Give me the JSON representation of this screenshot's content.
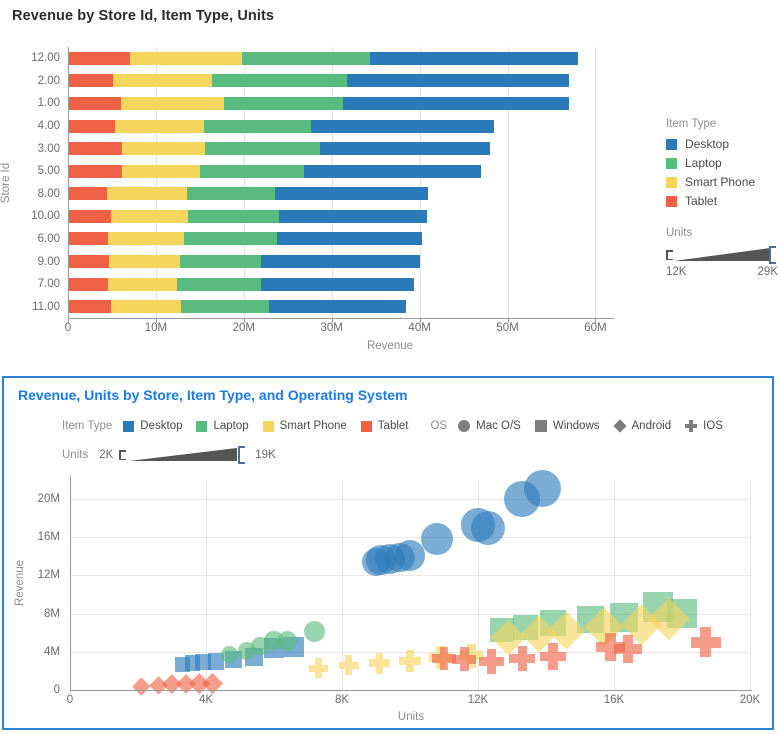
{
  "colors": {
    "desktop": "#2a7ab9",
    "laptop": "#59bb7e",
    "smart_phone": "#f6d55c",
    "tablet": "#ef6144",
    "os_gray": "#7d7d7d",
    "panel_border": "#2b7fd4",
    "panel_title": "#1a7ae8",
    "axis": "#9a9a9a",
    "grid": "#e3e3e3",
    "tick_text": "#6b6b6b",
    "axis_title": "#8d8d8d"
  },
  "bar_panel": {
    "title": "Revenue by Store Id, Item Type, Units",
    "legend": {
      "item_type_title": "Item Type",
      "items": [
        {
          "label": "Desktop",
          "color": "#2a7ab9"
        },
        {
          "label": "Laptop",
          "color": "#59bb7e"
        },
        {
          "label": "Smart Phone",
          "color": "#f6d55c"
        },
        {
          "label": "Tablet",
          "color": "#ef6144"
        }
      ],
      "units_title": "Units",
      "units_min": "12K",
      "units_max": "29K"
    }
  },
  "scatter_panel": {
    "title": "Revenue, Units by Store, Item Type, and Operating System",
    "item_type_label": "Item Type",
    "item_type_items": [
      {
        "label": "Desktop",
        "color": "#2a7ab9"
      },
      {
        "label": "Laptop",
        "color": "#59bb7e"
      },
      {
        "label": "Smart Phone",
        "color": "#f6d55c"
      },
      {
        "label": "Tablet",
        "color": "#ef6144"
      }
    ],
    "os_label": "OS",
    "os_items": [
      {
        "label": "Mac O/S",
        "shape": "circle-icon"
      },
      {
        "label": "Windows",
        "shape": "square-icon"
      },
      {
        "label": "Android",
        "shape": "diamond-icon"
      },
      {
        "label": "IOS",
        "shape": "plus-icon"
      }
    ],
    "units_label": "Units",
    "units_min": "2K",
    "units_max": "19K"
  },
  "chart_data": [
    {
      "type": "bar",
      "orientation": "horizontal",
      "stacked": true,
      "title": "Revenue by Store Id, Item Type, Units",
      "xlabel": "Revenue",
      "ylabel": "Store Id",
      "xlim": [
        0,
        62000000
      ],
      "xticks": [
        0,
        10000000,
        20000000,
        30000000,
        40000000,
        50000000,
        60000000
      ],
      "xticklabels": [
        "0",
        "10M",
        "20M",
        "30M",
        "40M",
        "50M",
        "60M"
      ],
      "grid": "vertical",
      "legend_position": "right",
      "categories": [
        "12.00",
        "2.00",
        "1.00",
        "4.00",
        "3.00",
        "5.00",
        "8.00",
        "10.00",
        "6.00",
        "9.00",
        "7.00",
        "11.00"
      ],
      "series": [
        {
          "name": "Tablet",
          "color": "#ef6144",
          "values": [
            7000000,
            5100000,
            6000000,
            5400000,
            6100000,
            6100000,
            4400000,
            4900000,
            4600000,
            4700000,
            4600000,
            4900000
          ]
        },
        {
          "name": "Smart Phone",
          "color": "#f6d55c",
          "values": [
            12800000,
            11300000,
            11800000,
            10100000,
            9500000,
            8900000,
            9100000,
            8700000,
            8600000,
            8000000,
            7800000,
            8000000
          ]
        },
        {
          "name": "Laptop",
          "color": "#59bb7e",
          "values": [
            14500000,
            15300000,
            13500000,
            12100000,
            13100000,
            11900000,
            10100000,
            10400000,
            10600000,
            9300000,
            9500000,
            10000000
          ]
        },
        {
          "name": "Desktop",
          "color": "#2a7ab9",
          "values": [
            23700000,
            25300000,
            25700000,
            20900000,
            19300000,
            20100000,
            17400000,
            16800000,
            16500000,
            18000000,
            17500000,
            15600000
          ]
        }
      ],
      "totals": [
        58000000,
        57000000,
        57000000,
        48500000,
        48000000,
        47000000,
        41000000,
        40800000,
        40300000,
        40000000,
        39400000,
        38500000
      ]
    },
    {
      "type": "scatter",
      "title": "Revenue, Units by Store, Item Type, and Operating System",
      "xlabel": "Units",
      "ylabel": "Revenue",
      "xlim": [
        0,
        20000
      ],
      "ylim": [
        0,
        22000000
      ],
      "xticks": [
        0,
        4000,
        8000,
        12000,
        16000,
        20000
      ],
      "xticklabels": [
        "0",
        "4K",
        "8K",
        "12K",
        "16K",
        "20K"
      ],
      "yticks": [
        0,
        4000000,
        8000000,
        12000000,
        16000000,
        20000000
      ],
      "yticklabels": [
        "0",
        "4M",
        "8M",
        "12M",
        "16M",
        "20M"
      ],
      "size_encoding": {
        "field": "Units",
        "min": 2000,
        "max": 19000
      },
      "color_encoding": {
        "field": "Item Type"
      },
      "shape_encoding": {
        "field": "OS"
      },
      "points": [
        {
          "x": 9000,
          "y": 13400,
          "u": 13000,
          "c": "#2a7ab9",
          "s": "circle"
        },
        {
          "x": 9150,
          "y": 13600,
          "u": 13400,
          "c": "#2a7ab9",
          "s": "circle"
        },
        {
          "x": 9400,
          "y": 13700,
          "u": 13700,
          "c": "#2a7ab9",
          "s": "circle"
        },
        {
          "x": 9700,
          "y": 13900,
          "u": 13500,
          "c": "#2a7ab9",
          "s": "circle"
        },
        {
          "x": 10000,
          "y": 14100,
          "u": 14200,
          "c": "#2a7ab9",
          "s": "circle"
        },
        {
          "x": 10800,
          "y": 15800,
          "u": 15000,
          "c": "#2a7ab9",
          "s": "circle"
        },
        {
          "x": 12000,
          "y": 17300,
          "u": 16000,
          "c": "#2a7ab9",
          "s": "circle"
        },
        {
          "x": 12300,
          "y": 17000,
          "u": 16400,
          "c": "#2a7ab9",
          "s": "circle"
        },
        {
          "x": 13300,
          "y": 20000,
          "u": 17500,
          "c": "#2a7ab9",
          "s": "circle"
        },
        {
          "x": 13900,
          "y": 21100,
          "u": 18600,
          "c": "#2a7ab9",
          "s": "circle"
        },
        {
          "x": 3300,
          "y": 2700,
          "u": 4200,
          "c": "#2a7ab9",
          "s": "square"
        },
        {
          "x": 3600,
          "y": 2800,
          "u": 4400,
          "c": "#2a7ab9",
          "s": "square"
        },
        {
          "x": 3900,
          "y": 2900,
          "u": 4600,
          "c": "#2a7ab9",
          "s": "square"
        },
        {
          "x": 4300,
          "y": 3000,
          "u": 4900,
          "c": "#2a7ab9",
          "s": "square"
        },
        {
          "x": 4800,
          "y": 3200,
          "u": 5400,
          "c": "#2a7ab9",
          "s": "square"
        },
        {
          "x": 5400,
          "y": 3500,
          "u": 6000,
          "c": "#2a7ab9",
          "s": "square"
        },
        {
          "x": 6000,
          "y": 4400,
          "u": 6800,
          "c": "#2a7ab9",
          "s": "square"
        },
        {
          "x": 6600,
          "y": 4500,
          "u": 7200,
          "c": "#2a7ab9",
          "s": "square"
        },
        {
          "x": 4700,
          "y": 3700,
          "u": 5500,
          "c": "#59bb7e",
          "s": "circle"
        },
        {
          "x": 5200,
          "y": 4100,
          "u": 6000,
          "c": "#59bb7e",
          "s": "circle"
        },
        {
          "x": 5600,
          "y": 4600,
          "u": 6300,
          "c": "#59bb7e",
          "s": "circle"
        },
        {
          "x": 6000,
          "y": 5200,
          "u": 6800,
          "c": "#59bb7e",
          "s": "circle"
        },
        {
          "x": 6400,
          "y": 5100,
          "u": 7000,
          "c": "#59bb7e",
          "s": "circle"
        },
        {
          "x": 7200,
          "y": 6100,
          "u": 7800,
          "c": "#59bb7e",
          "s": "circle"
        },
        {
          "x": 12700,
          "y": 6300,
          "u": 10000,
          "c": "#59bb7e",
          "s": "square"
        },
        {
          "x": 13400,
          "y": 6500,
          "u": 10500,
          "c": "#59bb7e",
          "s": "square"
        },
        {
          "x": 14200,
          "y": 7000,
          "u": 11200,
          "c": "#59bb7e",
          "s": "square"
        },
        {
          "x": 15300,
          "y": 7400,
          "u": 12000,
          "c": "#59bb7e",
          "s": "square"
        },
        {
          "x": 16300,
          "y": 7600,
          "u": 12600,
          "c": "#59bb7e",
          "s": "square"
        },
        {
          "x": 17300,
          "y": 8700,
          "u": 13800,
          "c": "#59bb7e",
          "s": "square"
        },
        {
          "x": 18000,
          "y": 8000,
          "u": 13200,
          "c": "#59bb7e",
          "s": "square"
        },
        {
          "x": 7300,
          "y": 2300,
          "u": 6800,
          "c": "#f6d55c",
          "s": "plus"
        },
        {
          "x": 8200,
          "y": 2600,
          "u": 7400,
          "c": "#f6d55c",
          "s": "plus"
        },
        {
          "x": 9100,
          "y": 2800,
          "u": 7900,
          "c": "#f6d55c",
          "s": "plus"
        },
        {
          "x": 10000,
          "y": 3000,
          "u": 8500,
          "c": "#f6d55c",
          "s": "plus"
        },
        {
          "x": 10900,
          "y": 3400,
          "u": 9200,
          "c": "#f6d55c",
          "s": "plus"
        },
        {
          "x": 11800,
          "y": 3600,
          "u": 9800,
          "c": "#f6d55c",
          "s": "plus"
        },
        {
          "x": 12900,
          "y": 5500,
          "u": 10400,
          "c": "#f6d55c",
          "s": "diamond"
        },
        {
          "x": 13800,
          "y": 5900,
          "u": 11000,
          "c": "#f6d55c",
          "s": "diamond"
        },
        {
          "x": 14600,
          "y": 6200,
          "u": 11600,
          "c": "#f6d55c",
          "s": "diamond"
        },
        {
          "x": 15700,
          "y": 6600,
          "u": 12300,
          "c": "#f6d55c",
          "s": "diamond"
        },
        {
          "x": 16800,
          "y": 6900,
          "u": 13000,
          "c": "#f6d55c",
          "s": "diamond"
        },
        {
          "x": 17600,
          "y": 7400,
          "u": 13600,
          "c": "#f6d55c",
          "s": "diamond"
        },
        {
          "x": 2100,
          "y": 400,
          "u": 2400,
          "c": "#ef6144",
          "s": "diamond"
        },
        {
          "x": 2600,
          "y": 500,
          "u": 2800,
          "c": "#ef6144",
          "s": "diamond"
        },
        {
          "x": 3000,
          "y": 600,
          "u": 3100,
          "c": "#ef6144",
          "s": "diamond"
        },
        {
          "x": 3400,
          "y": 600,
          "u": 3400,
          "c": "#ef6144",
          "s": "diamond"
        },
        {
          "x": 3800,
          "y": 700,
          "u": 3700,
          "c": "#ef6144",
          "s": "diamond"
        },
        {
          "x": 4200,
          "y": 700,
          "u": 4000,
          "c": "#ef6144",
          "s": "diamond"
        },
        {
          "x": 11000,
          "y": 3300,
          "u": 9500,
          "c": "#ef6144",
          "s": "plus"
        },
        {
          "x": 11600,
          "y": 3200,
          "u": 9900,
          "c": "#ef6144",
          "s": "plus"
        },
        {
          "x": 12400,
          "y": 3000,
          "u": 10300,
          "c": "#ef6144",
          "s": "plus"
        },
        {
          "x": 13300,
          "y": 3300,
          "u": 10800,
          "c": "#ef6144",
          "s": "plus"
        },
        {
          "x": 14200,
          "y": 3500,
          "u": 11400,
          "c": "#ef6144",
          "s": "plus"
        },
        {
          "x": 15900,
          "y": 4500,
          "u": 12800,
          "c": "#ef6144",
          "s": "plus"
        },
        {
          "x": 16400,
          "y": 4300,
          "u": 12400,
          "c": "#ef6144",
          "s": "plus"
        },
        {
          "x": 18700,
          "y": 5000,
          "u": 13500,
          "c": "#ef6144",
          "s": "plus"
        }
      ]
    }
  ]
}
